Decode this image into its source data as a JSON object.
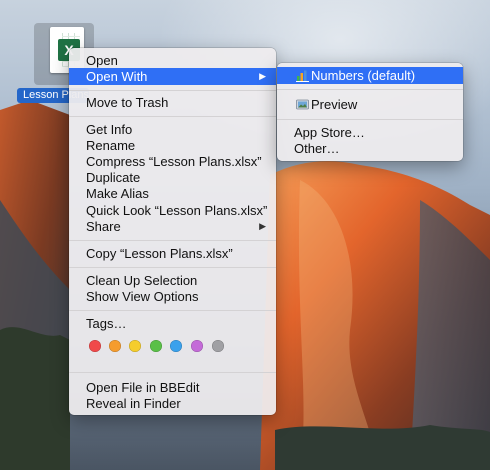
{
  "desktop": {
    "file": {
      "label": "Lesson Plans.xlsx",
      "icon": "excel-document-icon",
      "badge_letter": "X"
    }
  },
  "context_menu": {
    "items": {
      "open": "Open",
      "open_with": "Open With",
      "move_to_trash": "Move to Trash",
      "get_info": "Get Info",
      "rename": "Rename",
      "compress": "Compress “Lesson Plans.xlsx”",
      "duplicate": "Duplicate",
      "make_alias": "Make Alias",
      "quick_look": "Quick Look “Lesson Plans.xlsx”",
      "share": "Share",
      "copy": "Copy “Lesson Plans.xlsx”",
      "clean_up_selection": "Clean Up Selection",
      "show_view_options": "Show View Options",
      "tags": "Tags…",
      "open_in_bbedit": "Open File in BBEdit",
      "reveal_in_finder": "Reveal in Finder"
    },
    "selected": "Open With",
    "tag_colors": [
      "#f0494a",
      "#f59c2e",
      "#f5cd2c",
      "#5ac048",
      "#3aa1ec",
      "#c46bd8",
      "#a0a0a4"
    ]
  },
  "open_with_submenu": {
    "items": {
      "numbers": "Numbers (default)",
      "preview": "Preview",
      "app_store": "App Store…",
      "other": "Other…"
    },
    "selected": "Numbers (default)"
  },
  "colors": {
    "selection": "#2f6ff5",
    "file_label_bg": "#2466c9",
    "excel_green": "#1f7244"
  }
}
